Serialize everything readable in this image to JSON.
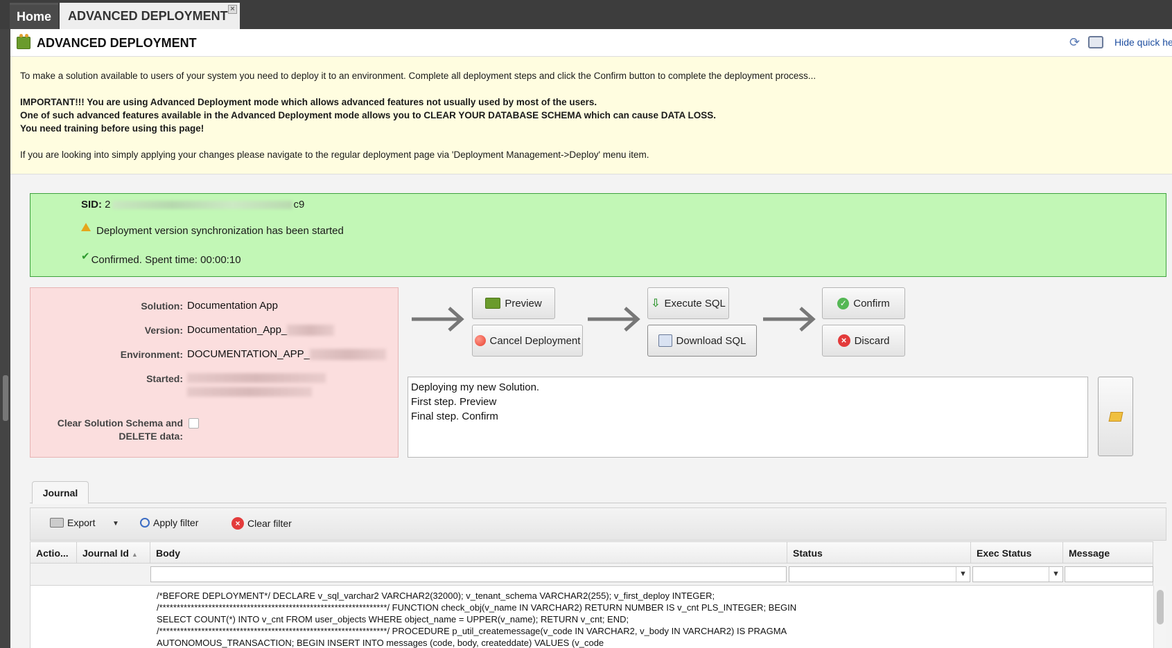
{
  "tabs": {
    "home": "Home",
    "active": "ADVANCED DEPLOYMENT",
    "close": "×"
  },
  "header": {
    "title": "ADVANCED DEPLOYMENT",
    "hide_help": "Hide quick he"
  },
  "help": {
    "intro": "To make a solution available to users of your system you need to deploy it to an environment. Complete all deployment steps and click the Confirm button to complete the deployment process...",
    "important_1": "IMPORTANT!!! You are using Advanced Deployment mode which allows advanced features not usually used by most of the users.",
    "important_2": "One of such advanced features available in the Advanced Deployment mode allows you to CLEAR YOUR DATABASE SCHEMA which can cause DATA LOSS.",
    "important_3": "You need training before using this page!",
    "footer": "If you are looking into simply applying your changes please navigate to the regular deployment page via 'Deployment Management->Deploy' menu item."
  },
  "status": {
    "sid_label": "SID:",
    "sid_prefix": "2",
    "sid_suffix": "c9",
    "message_started": "Deployment version synchronization has been started",
    "message_confirmed": "Confirmed. Spent time: 00:00:10"
  },
  "info": {
    "solution_label": "Solution:",
    "solution_value": "Documentation App",
    "version_label": "Version:",
    "version_value": "Documentation_App_",
    "environment_label": "Environment:",
    "environment_value": "DOCUMENTATION_APP_",
    "started_label": "Started:",
    "clear_label_1": "Clear Solution Schema and",
    "clear_label_2": "DELETE data:"
  },
  "buttons": {
    "preview": "Preview",
    "cancel": "Cancel Deployment",
    "execute_sql": "Execute SQL",
    "download_sql": "Download SQL",
    "confirm": "Confirm",
    "discard": "Discard"
  },
  "notes": {
    "text": "Deploying my new Solution.\nFirst step. Preview\nFinal step. Confirm"
  },
  "journal": {
    "tab_label": "Journal",
    "toolbar": {
      "export": "Export",
      "apply_filter": "Apply filter",
      "clear_filter": "Clear filter"
    },
    "columns": [
      "Actio...",
      "Journal Id",
      "Body",
      "Status",
      "Exec Status",
      "Message"
    ],
    "rows": [
      {
        "body": "/*BEFORE DEPLOYMENT*/ DECLARE v_sql_varchar2 VARCHAR2(32000); v_tenant_schema VARCHAR2(255); v_first_deploy INTEGER; /*****************************************************************/ FUNCTION check_obj(v_name IN VARCHAR2) RETURN NUMBER IS v_cnt PLS_INTEGER; BEGIN SELECT COUNT(*) INTO v_cnt FROM user_objects WHERE object_name = UPPER(v_name); RETURN v_cnt; END; /*****************************************************************/ PROCEDURE p_util_createmessage(v_code IN VARCHAR2, v_body IN VARCHAR2) IS PRAGMA AUTONOMOUS_TRANSACTION; BEGIN INSERT INTO messages (code, body, createddate) VALUES (v_code"
      }
    ]
  },
  "colors": {
    "status_bg": "#c2f7b6",
    "info_bg": "#fbdede",
    "help_bg": "#fffde0"
  }
}
